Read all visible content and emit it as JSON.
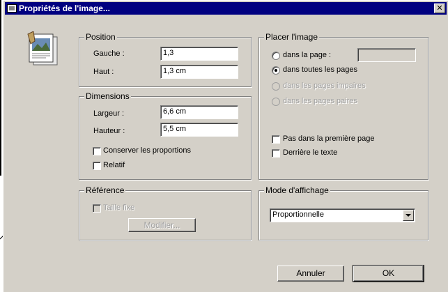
{
  "window": {
    "title": "Propriétés de l'image..."
  },
  "position": {
    "legend": "Position",
    "left_label": "Gauche :",
    "left_value": "1,3",
    "top_label": "Haut :",
    "top_value": "1,3 cm"
  },
  "dimensions": {
    "legend": "Dimensions",
    "width_label": "Largeur :",
    "width_value": "6,6 cm",
    "height_label": "Hauteur :",
    "height_value": "5,5 cm",
    "keep_ratio_label": "Conserver les proportions",
    "keep_ratio_checked": false,
    "relative_label": "Relatif",
    "relative_checked": false
  },
  "reference": {
    "legend": "Référence",
    "fixed_size_label": "Taille fixe",
    "modify_button": "Modifier..."
  },
  "placement": {
    "legend": "Placer l'image",
    "on_page_label": "dans la page :",
    "on_page_value": "",
    "all_pages_label": "dans toutes les pages",
    "odd_pages_label": "dans les pages impaires",
    "even_pages_label": "dans les pages paires",
    "selected": "all_pages",
    "not_first_page_label": "Pas dans la première page",
    "behind_text_label": "Derrière le texte"
  },
  "display_mode": {
    "legend": "Mode d'affichage",
    "selected": "Proportionnelle"
  },
  "buttons": {
    "cancel": "Annuler",
    "ok": "OK"
  },
  "icons": [
    "image-properties-icon",
    "window-app-icon",
    "close-icon",
    "dropdown-arrow-icon"
  ]
}
